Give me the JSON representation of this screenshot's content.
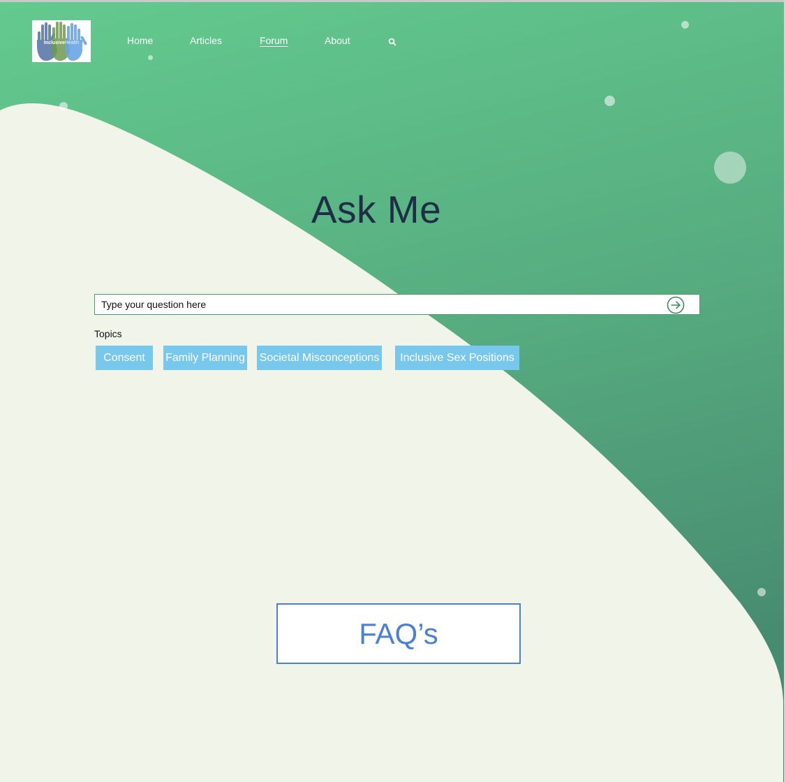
{
  "brand": {
    "logo_text_main": "Inclusive",
    "logo_text_sub": "Health",
    "logo_icon": "raised-hands-icon"
  },
  "nav": {
    "items": [
      {
        "label": "Home",
        "active": false
      },
      {
        "label": "Articles",
        "active": false
      },
      {
        "label": "Forum",
        "active": true
      },
      {
        "label": "About",
        "active": false
      }
    ],
    "search_icon": "search-icon"
  },
  "hero": {
    "title": "Ask Me"
  },
  "search": {
    "placeholder": "Type your question here",
    "value": "",
    "submit_icon": "arrow-right-circle-icon"
  },
  "topics": {
    "label": "Topics",
    "items": [
      "Consent",
      "Family Planning",
      "Societal Misconceptions",
      "Inclusive Sex Positions"
    ]
  },
  "faq": {
    "label": "FAQ’s"
  },
  "colors": {
    "gradient_top": "#62c98e",
    "gradient_bottom": "#4a8f72",
    "cream": "#f1f4e8",
    "title": "#1f2e44",
    "topic_bg": "#78c8ee",
    "faq_accent": "#4a80d6"
  }
}
